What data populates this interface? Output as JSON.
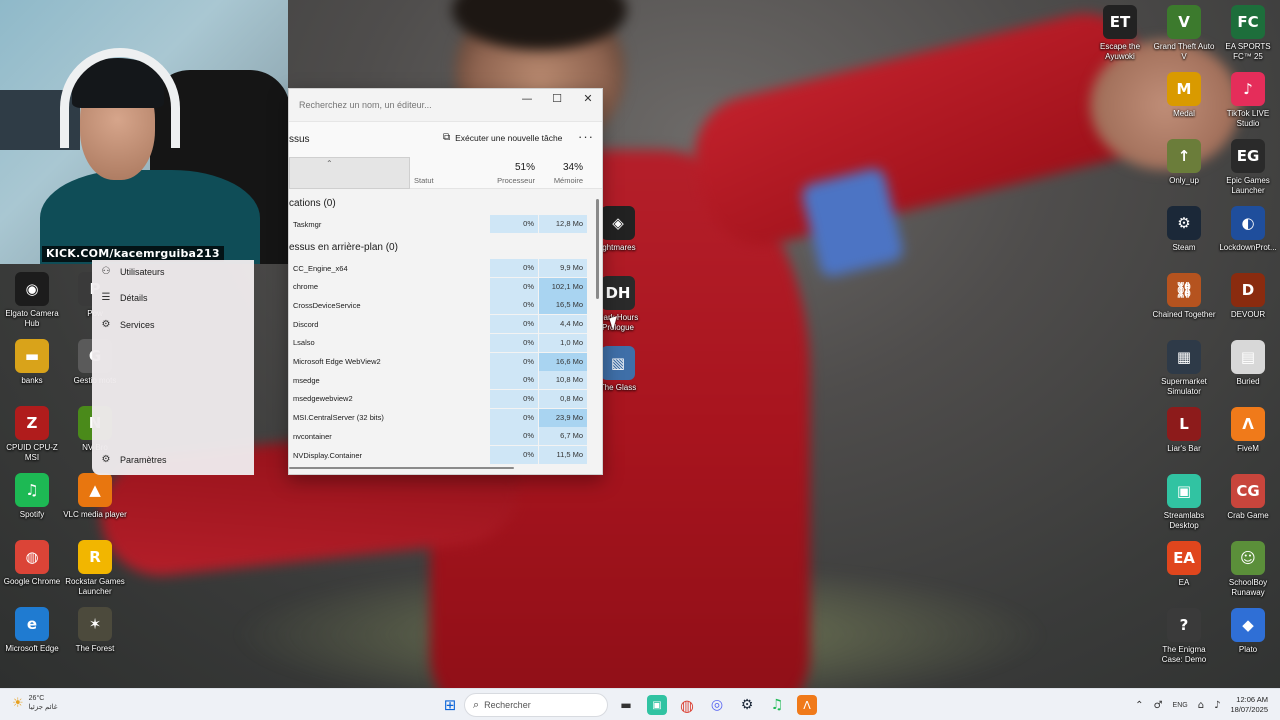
{
  "webcam": {
    "overlay_text": "KICK.COM/kacemrguiba213"
  },
  "task_manager": {
    "search_placeholder": "Recherchez un nom, un éditeur...",
    "window_controls": {
      "minimize": "—",
      "maximize": "☐",
      "close": "✕"
    },
    "page_title": "ssus",
    "run_task_label": "Exécuter une nouvelle tâche",
    "more_label": "···",
    "columns": {
      "status": "Statut",
      "cpu_pct": "51%",
      "cpu_label": "Processeur",
      "mem_pct": "34%",
      "mem_label": "Mémoire"
    },
    "groups": {
      "apps": "cations (0)",
      "background": "essus en arrière-plan (0)"
    },
    "app_processes": [
      {
        "name": "Taskmgr",
        "cpu": "0%",
        "mem": "12,8 Mo"
      }
    ],
    "background_processes": [
      {
        "name": "CC_Engine_x64",
        "cpu": "0%",
        "mem": "9,9 Mo"
      },
      {
        "name": "chrome",
        "cpu": "0%",
        "mem": "102,1 Mo"
      },
      {
        "name": "CrossDeviceService",
        "cpu": "0%",
        "mem": "16,5 Mo"
      },
      {
        "name": "Discord",
        "cpu": "0%",
        "mem": "4,4 Mo"
      },
      {
        "name": "Lsalso",
        "cpu": "0%",
        "mem": "1,0 Mo"
      },
      {
        "name": "Microsoft Edge WebView2",
        "cpu": "0%",
        "mem": "16,6 Mo"
      },
      {
        "name": "msedge",
        "cpu": "0%",
        "mem": "10,8 Mo"
      },
      {
        "name": "msedgewebview2",
        "cpu": "0%",
        "mem": "0,8 Mo"
      },
      {
        "name": "MSI.CentralServer (32 bits)",
        "cpu": "0%",
        "mem": "23,9 Mo"
      },
      {
        "name": "nvcontainer",
        "cpu": "0%",
        "mem": "6,7 Mo"
      },
      {
        "name": "NVDisplay.Container",
        "cpu": "0%",
        "mem": "11,5 Mo"
      }
    ],
    "nav": {
      "users": "Utilisateurs",
      "details": "Détails",
      "services": "Services",
      "settings": "Paramètres"
    }
  },
  "desktop_icons": {
    "left": [
      {
        "label": "Elgato Camera Hub",
        "glyph": "◉",
        "color": "#1c1c1c"
      },
      {
        "label": "banks",
        "glyph": "▬",
        "color": "#d9a31a"
      },
      {
        "label": "CPUID CPU-Z MSI",
        "glyph": "Z",
        "color": "#b01c1c"
      },
      {
        "label": "Spotify",
        "glyph": "♫",
        "color": "#1db954"
      },
      {
        "label": "Google Chrome",
        "glyph": "◍",
        "color": "#db4437"
      },
      {
        "label": "Microsoft Edge",
        "glyph": "e",
        "color": "#1f7bd1"
      }
    ],
    "left2": [
      {
        "label": "Pow",
        "glyph": "P",
        "color": "#3a3a3a"
      },
      {
        "label": "Gestio mots",
        "glyph": "G",
        "color": "#5a5a5a"
      },
      {
        "label": "NV Bro",
        "glyph": "N",
        "color": "#4a8a1a"
      },
      {
        "label": "VLC media player",
        "glyph": "▲",
        "color": "#e8760f"
      },
      {
        "label": "Rockstar Games Launcher",
        "glyph": "R",
        "color": "#f2b600"
      },
      {
        "label": "The Forest",
        "glyph": "✶",
        "color": "#4c4a3c"
      }
    ],
    "middle": [
      {
        "label": "ightmares",
        "glyph": "◈",
        "color": "#222"
      },
      {
        "label": "Dark Hours Prologue",
        "glyph": "DH",
        "color": "#2a2a2a"
      },
      {
        "label": "The Glass",
        "glyph": "▧",
        "color": "#3f6fa8"
      }
    ],
    "right_col1": [
      {
        "label": "Escape the Ayuwoki",
        "glyph": "ET",
        "color": "#222"
      },
      {
        "label": "Medal",
        "glyph": "M",
        "color": "#d99a00"
      },
      {
        "label": "Only_up",
        "glyph": "↑",
        "color": "#6b7d3a"
      },
      {
        "label": "Steam",
        "glyph": "⚙",
        "color": "#1b2838"
      },
      {
        "label": "Chained Together",
        "glyph": "⛓",
        "color": "#b5531f"
      },
      {
        "label": "Supermarket Simulator",
        "glyph": "▦",
        "color": "#2e3a48"
      },
      {
        "label": "Liar's Bar",
        "glyph": "L",
        "color": "#8d1b1b"
      },
      {
        "label": "Streamlabs Desktop",
        "glyph": "▣",
        "color": "#31c3a2"
      },
      {
        "label": "EA",
        "glyph": "EA",
        "color": "#e0461d"
      },
      {
        "label": "The Enigma Case: Demo",
        "glyph": "?",
        "color": "#3a3a3a"
      }
    ],
    "right_col0": [
      {
        "label": "Grand Theft Auto V",
        "glyph": "V",
        "color": "#3c7a2d"
      }
    ],
    "right_col2": [
      {
        "label": "EA SPORTS FC™ 25",
        "glyph": "FC",
        "color": "#1d6e3b"
      },
      {
        "label": "TikTok LIVE Studio",
        "glyph": "♪",
        "color": "#e52d5a"
      },
      {
        "label": "Epic Games Launcher",
        "glyph": "EG",
        "color": "#2a2a2a"
      },
      {
        "label": "LockdownProt...",
        "glyph": "◐",
        "color": "#1f4e9c"
      },
      {
        "label": "DEVOUR",
        "glyph": "D",
        "color": "#8a2b0f"
      },
      {
        "label": "Buried",
        "glyph": "▤",
        "color": "#d8d8d8"
      },
      {
        "label": "FiveM",
        "glyph": "Λ",
        "color": "#f07a1a"
      },
      {
        "label": "Crab Game",
        "glyph": "CG",
        "color": "#c8453c"
      },
      {
        "label": "SchoolBoy Runaway",
        "glyph": "☺",
        "color": "#5b8f3a"
      },
      {
        "label": "Plato",
        "glyph": "◆",
        "color": "#2f6fd6"
      }
    ]
  },
  "taskbar": {
    "weather_temp": "26°C",
    "weather_desc": "غائم جزئيا",
    "search_placeholder": "Rechercher",
    "language": "ENG",
    "time": "12:06 AM",
    "date": "18/07/2025"
  }
}
